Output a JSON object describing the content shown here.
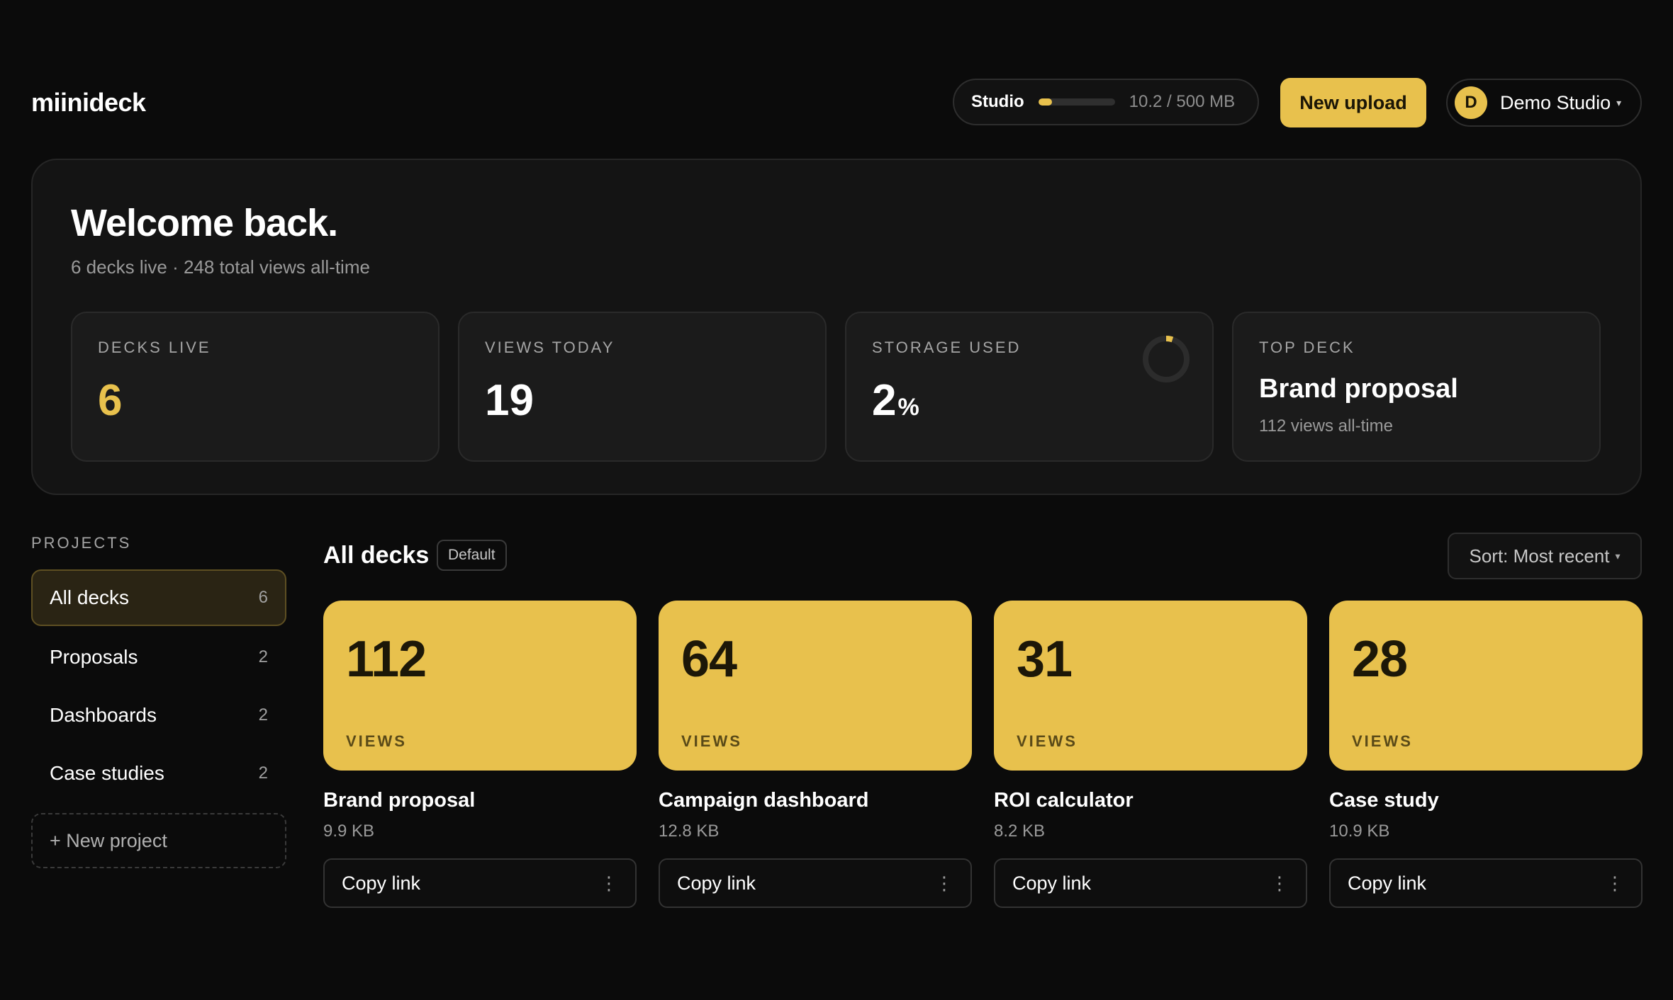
{
  "header": {
    "logo": "miinideck",
    "plan_name": "Studio",
    "storage_fraction": 0.02,
    "storage_text": "10.2 / 500 MB",
    "upload_label": "New upload",
    "account_initial": "D",
    "account_name": "Demo Studio",
    "caret": "▾"
  },
  "hero": {
    "title": "Welcome back.",
    "subtitle": "6 decks live · 248 total views all-time",
    "stats": {
      "decks_live": {
        "label": "DECKS LIVE",
        "value": "6"
      },
      "views_today": {
        "label": "VIEWS TODAY",
        "value": "19"
      },
      "storage_used": {
        "label": "STORAGE USED",
        "value": "2",
        "unit": "%",
        "fraction": 0.02
      },
      "top_deck": {
        "label": "TOP DECK",
        "name": "Brand proposal",
        "views": "112 views all-time"
      }
    }
  },
  "sidebar": {
    "label": "PROJECTS",
    "items": [
      {
        "label": "All decks",
        "count": "6",
        "active": true
      },
      {
        "label": "Proposals",
        "count": "2",
        "active": false
      },
      {
        "label": "Dashboards",
        "count": "2",
        "active": false
      },
      {
        "label": "Case studies",
        "count": "2",
        "active": false
      }
    ],
    "new_project": "+ New project"
  },
  "main": {
    "title": "All decks",
    "badge": "Default",
    "sort_label": "Sort: Most recent",
    "decks": [
      {
        "views": "112",
        "views_label": "VIEWS",
        "name": "Brand proposal",
        "size": "9.9 KB",
        "copy_label": "Copy link",
        "menu": "⋮"
      },
      {
        "views": "64",
        "views_label": "VIEWS",
        "name": "Campaign dashboard",
        "size": "12.8 KB",
        "copy_label": "Copy link",
        "menu": "⋮"
      },
      {
        "views": "31",
        "views_label": "VIEWS",
        "name": "ROI calculator",
        "size": "8.2 KB",
        "copy_label": "Copy link",
        "menu": "⋮"
      },
      {
        "views": "28",
        "views_label": "VIEWS",
        "name": "Case study",
        "size": "10.9 KB",
        "copy_label": "Copy link",
        "menu": "⋮"
      }
    ]
  },
  "colors": {
    "accent": "#e8c14d",
    "background": "#0b0b0b",
    "panel": "#141414",
    "card": "#1b1b1b"
  }
}
